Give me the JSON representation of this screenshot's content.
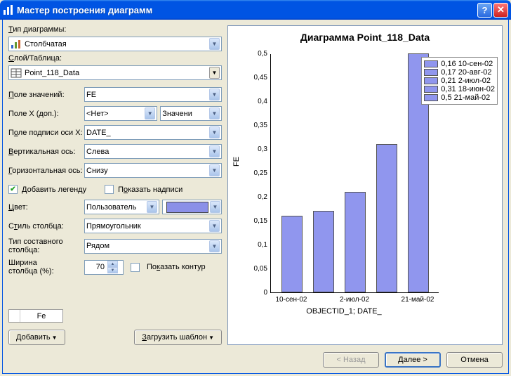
{
  "window": {
    "title": "Мастер построения диаграмм"
  },
  "left": {
    "type_label": "Тип диаграммы:",
    "type_value": "Столбчатая",
    "layer_label": "Слой/Таблица:",
    "layer_value": "Point_118_Data",
    "value_field_label": "Поле значений:",
    "value_field": "FE",
    "x_field_label": "Поле X (доп.):",
    "x_field": "<Нет>",
    "x_extra": "Значени",
    "x_axis_label_label": "Поле подписи оси X:",
    "x_axis_label": "DATE_",
    "vert_axis_label": "Вертикальная ось:",
    "vert_axis": "Слева",
    "horiz_axis_label": "Горизонтальная ось:",
    "horiz_axis": "Снизу",
    "add_legend": "Добавить легенду",
    "show_labels": "Показать надписи",
    "color_label": "Цвет:",
    "color_mode": "Пользователь",
    "bar_style_label": "Стиль столбца:",
    "bar_style": "Прямоугольник",
    "multi_label1": "Тип составного",
    "multi_label2": "столбца:",
    "multi": "Рядом",
    "width_label1": "Ширина",
    "width_label2": "столбца (%):",
    "width_val": "70",
    "show_outline": "Показать контур",
    "series_tab": "Fe",
    "add_btn": "Добавить",
    "load_btn": "Загрузить шаблон"
  },
  "footer": {
    "back": "< Назад",
    "next": "Далее >",
    "cancel": "Отмена"
  },
  "chart_data": {
    "type": "bar",
    "title": "Диаграмма  Point_118_Data",
    "ylabel": "FE",
    "xlabel": "OBJECTID_1; DATE_",
    "ylim": [
      0,
      0.5
    ],
    "yticks": [
      "0",
      "0,05",
      "0,1",
      "0,15",
      "0,2",
      "0,25",
      "0,3",
      "0,35",
      "0,4",
      "0,45",
      "0,5"
    ],
    "categories": [
      "10-сен-02",
      "20-авг-02",
      "2-июл-02",
      "18-июн-02",
      "21-май-02"
    ],
    "x_tick_labels": [
      "10-сен-02",
      "2-июл-02",
      "21-май-02"
    ],
    "values": [
      0.16,
      0.17,
      0.21,
      0.31,
      0.5
    ],
    "legend": [
      "0,16 10-сен-02",
      "0,17 20-авг-02",
      "0,21 2-июл-02",
      "0,31 18-июн-02",
      "  0,5 21-май-02"
    ]
  }
}
